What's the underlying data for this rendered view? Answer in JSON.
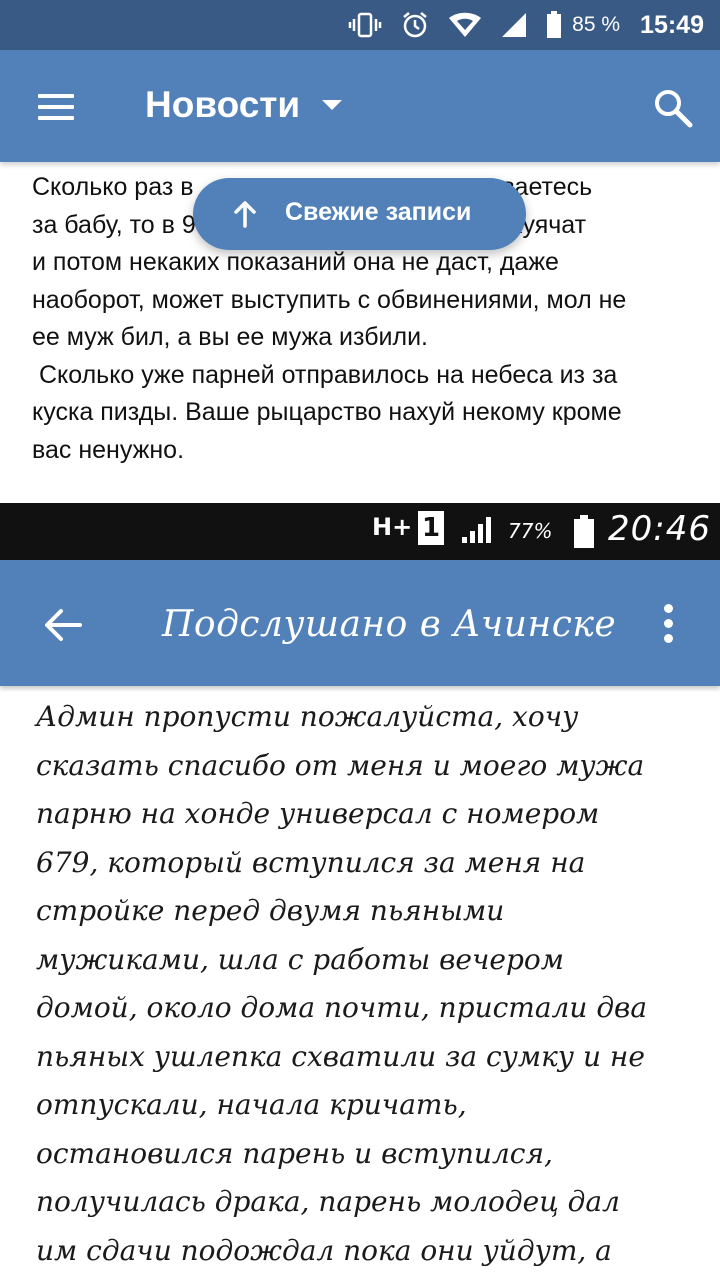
{
  "status_bar": {
    "battery_percent": "85 %",
    "time": "15:49",
    "icons": [
      "vibrate-icon",
      "alarm-icon",
      "wifi-icon",
      "signal-icon",
      "battery-icon"
    ]
  },
  "app_bar": {
    "title": "Новости",
    "icons": [
      "menu-icon",
      "chevron-down-icon",
      "search-icon"
    ]
  },
  "post": {
    "text_visible": "Сколько раз в                                    писываетесь\nза бабу, то в 9                                   вас отхуячат\nи потом некаких показаний она не даст, даже\nнаоборот, может выступить с обвинениями, мол не\nее муж бил, а вы ее мужа избили.\n Сколько уже парней отправилось на небеса из за\nкуска пизды. Ваше рыцарство нахуй некому кроме\nвас ненужно."
  },
  "fresh_button": {
    "label": "Свежие записи"
  },
  "embedded_screenshot": {
    "status": {
      "network": "H+",
      "sim": "1",
      "battery_percent": "77%",
      "time": "20:46"
    },
    "title": "Подслушано в Ачинске",
    "lines": [
      "Админ пропусти пожалуйста, хочу",
      "сказать спасибо от меня и моего мужа",
      "парню на хонде универсал с номером",
      "679,  который вступился за меня на",
      "стройке перед двумя пьяными",
      "мужиками, шла с работы вечером",
      "домой, около дома почти, пристали два",
      "пьяных ушлепка схватили за сумку и не",
      "отпускали, начала кричать,",
      "остановился парень и вступился,",
      "получилась драка, парень молодец дал",
      "им сдачи подождал пока они уйдут, а"
    ]
  },
  "colors": {
    "status_bar": "#3a5a86",
    "app_bar": "#5181b8",
    "pill": "#5181b8",
    "embedded_status": "#111111"
  }
}
